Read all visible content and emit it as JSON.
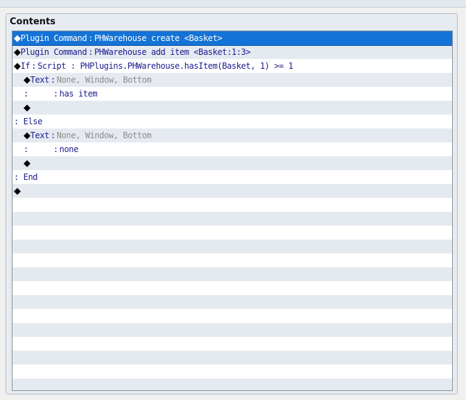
{
  "panel": {
    "title": "Contents"
  },
  "rows": [
    {
      "indent": 0,
      "diamond": true,
      "cmd": "Plugin Command",
      "sep": ":",
      "args": "PHWarehouse create <Basket>",
      "args_muted": false,
      "selected": true
    },
    {
      "indent": 0,
      "diamond": true,
      "cmd": "Plugin Command",
      "sep": ":",
      "args": "PHWarehouse add item <Basket:1:3>",
      "args_muted": false,
      "selected": false
    },
    {
      "indent": 0,
      "diamond": true,
      "cmd": "If",
      "sep": ":",
      "args": "Script : PHPlugins.PHWarehouse.hasItem(Basket, 1) >= 1",
      "args_muted": false,
      "selected": false
    },
    {
      "indent": 1,
      "diamond": true,
      "cmd": "Text",
      "sep": ":",
      "args": "None, Window, Bottom",
      "args_muted": true,
      "selected": false
    },
    {
      "indent": 1,
      "diamond": false,
      "cmd": ":",
      "sep": ":",
      "args": "has item",
      "args_muted": false,
      "selected": false,
      "continuation": true
    },
    {
      "indent": 1,
      "diamond": true,
      "cmd": "",
      "sep": "",
      "args": "",
      "args_muted": false,
      "selected": false
    },
    {
      "indent": 0,
      "diamond": false,
      "cmd": ": Else",
      "sep": "",
      "args": "",
      "args_muted": false,
      "selected": false,
      "branch": true
    },
    {
      "indent": 1,
      "diamond": true,
      "cmd": "Text",
      "sep": ":",
      "args": "None, Window, Bottom",
      "args_muted": true,
      "selected": false
    },
    {
      "indent": 1,
      "diamond": false,
      "cmd": ":",
      "sep": ":",
      "args": "none",
      "args_muted": false,
      "selected": false,
      "continuation": true
    },
    {
      "indent": 1,
      "diamond": true,
      "cmd": "",
      "sep": "",
      "args": "",
      "args_muted": false,
      "selected": false
    },
    {
      "indent": 0,
      "diamond": false,
      "cmd": ": End",
      "sep": "",
      "args": "",
      "args_muted": false,
      "selected": false,
      "branch": true
    },
    {
      "indent": 0,
      "diamond": true,
      "cmd": "",
      "sep": "",
      "args": "",
      "args_muted": false,
      "selected": false
    }
  ],
  "diamond_glyph": "◆"
}
